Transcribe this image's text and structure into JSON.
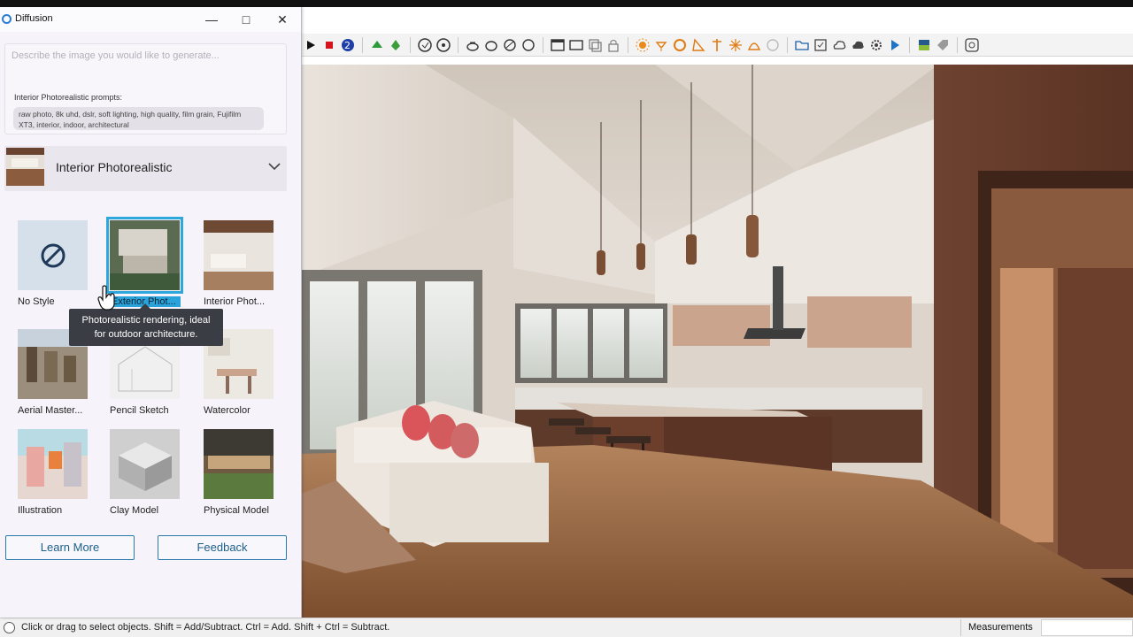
{
  "window": {
    "title": "Diffusion"
  },
  "prompt": {
    "placeholder": "Describe the image you would like to generate...",
    "hint_label": "Interior Photorealistic prompts:",
    "hint_text": "raw photo, 8k uhd, dslr, soft lighting, high quality, film grain, Fujifilm XT3, interior, indoor, architectural"
  },
  "style_selector": {
    "selected": "Interior Photorealistic"
  },
  "styles": [
    {
      "label": "No Style",
      "icon": "no-style-icon"
    },
    {
      "label": "Exterior Phot...",
      "selected": true
    },
    {
      "label": "Interior Phot..."
    },
    {
      "label": "Aerial Master..."
    },
    {
      "label": "Pencil Sketch"
    },
    {
      "label": "Watercolor"
    },
    {
      "label": "Illustration"
    },
    {
      "label": "Clay Model"
    },
    {
      "label": "Physical Model"
    }
  ],
  "tooltip": {
    "line1": "Photorealistic rendering, ideal",
    "line2": "for outdoor architecture."
  },
  "buttons": {
    "learn_more": "Learn More",
    "feedback": "Feedback"
  },
  "status": {
    "text": "Click or drag to select objects. Shift = Add/Subtract. Ctrl = Add. Shift + Ctrl = Subtract.",
    "measurements_label": "Measurements"
  },
  "colors": {
    "accent": "#2ea8dc",
    "button_border": "#2a79a8"
  }
}
